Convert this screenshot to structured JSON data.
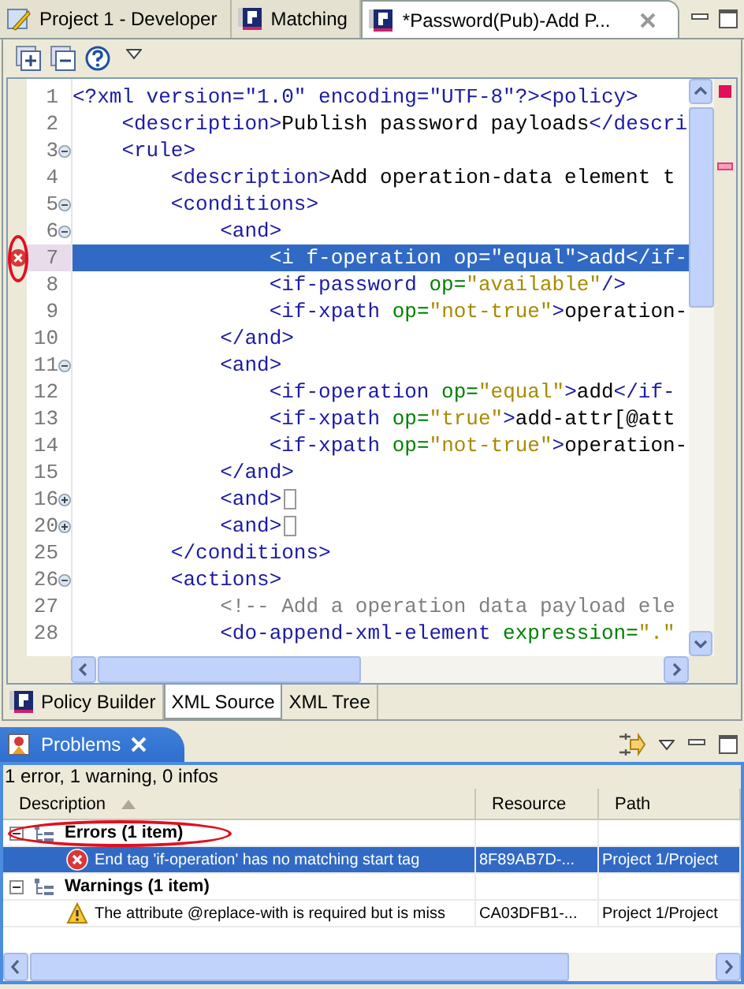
{
  "editor_tabs": [
    {
      "label": "Project 1 - Developer",
      "kind": "project",
      "selected": false,
      "closable": false
    },
    {
      "label": "Matching",
      "kind": "policy",
      "selected": false,
      "closable": false
    },
    {
      "label": "*Password(Pub)-Add P...",
      "kind": "policy",
      "selected": true,
      "closable": true
    }
  ],
  "editor": {
    "lines": [
      {
        "number": "1",
        "selected": false,
        "segments": [
          {
            "kind": "tag",
            "text": "<?xml version=\"1.0\" encoding=\"UTF-8\"?><policy>"
          }
        ]
      },
      {
        "number": "2",
        "selected": false,
        "segments": [
          {
            "kind": "tag",
            "text": "    <description>"
          },
          {
            "kind": "text",
            "text": "Publish password payloads"
          },
          {
            "kind": "tag",
            "text": "</descri"
          }
        ]
      },
      {
        "number": "3",
        "expanded": true,
        "selected": false,
        "segments": [
          {
            "kind": "tag",
            "text": "    <rule>"
          }
        ]
      },
      {
        "number": "4",
        "selected": false,
        "segments": [
          {
            "kind": "tag",
            "text": "        <description>"
          },
          {
            "kind": "text",
            "text": "Add operation-data element t"
          }
        ]
      },
      {
        "number": "5",
        "expanded": true,
        "selected": false,
        "segments": [
          {
            "kind": "tag",
            "text": "        <conditions>"
          }
        ]
      },
      {
        "number": "6",
        "expanded": true,
        "selected": false,
        "segments": [
          {
            "kind": "tag",
            "text": "            <and>"
          }
        ]
      },
      {
        "number": "7",
        "selected": true,
        "error": true,
        "circled": true,
        "segments": [
          {
            "kind": "tag",
            "text": "                <i f-operation op=\"equal\">add</if-"
          }
        ]
      },
      {
        "number": "8",
        "selected": false,
        "segments": [
          {
            "kind": "tag",
            "text": "                <if-password"
          },
          {
            "kind": "attr",
            "text": " op="
          },
          {
            "kind": "value",
            "text": "\"available\""
          },
          {
            "kind": "tag",
            "text": "/>"
          }
        ]
      },
      {
        "number": "9",
        "selected": false,
        "segments": [
          {
            "kind": "tag",
            "text": "                <if-xpath"
          },
          {
            "kind": "attr",
            "text": " op="
          },
          {
            "kind": "value",
            "text": "\"not-true\""
          },
          {
            "kind": "tag",
            "text": ">"
          },
          {
            "kind": "text",
            "text": "operation-"
          }
        ]
      },
      {
        "number": "10",
        "selected": false,
        "segments": [
          {
            "kind": "tag",
            "text": "            </and>"
          }
        ]
      },
      {
        "number": "11",
        "expanded": true,
        "selected": false,
        "segments": [
          {
            "kind": "tag",
            "text": "            <and>"
          }
        ]
      },
      {
        "number": "12",
        "selected": false,
        "segments": [
          {
            "kind": "tag",
            "text": "                <if-operation"
          },
          {
            "kind": "attr",
            "text": " op="
          },
          {
            "kind": "value",
            "text": "\"equal\""
          },
          {
            "kind": "tag",
            "text": ">"
          },
          {
            "kind": "text",
            "text": "add"
          },
          {
            "kind": "tag",
            "text": "</if-"
          }
        ]
      },
      {
        "number": "13",
        "selected": false,
        "segments": [
          {
            "kind": "tag",
            "text": "                <if-xpath"
          },
          {
            "kind": "attr",
            "text": " op="
          },
          {
            "kind": "value",
            "text": "\"true\""
          },
          {
            "kind": "tag",
            "text": ">"
          },
          {
            "kind": "text",
            "text": "add-attr[@att"
          }
        ]
      },
      {
        "number": "14",
        "selected": false,
        "segments": [
          {
            "kind": "tag",
            "text": "                <if-xpath"
          },
          {
            "kind": "attr",
            "text": " op="
          },
          {
            "kind": "value",
            "text": "\"not-true\""
          },
          {
            "kind": "tag",
            "text": ">"
          },
          {
            "kind": "text",
            "text": "operation-"
          }
        ]
      },
      {
        "number": "15",
        "selected": false,
        "segments": [
          {
            "kind": "tag",
            "text": "            </and>"
          }
        ]
      },
      {
        "number": "16",
        "expanded": false,
        "selected": false,
        "segments": [
          {
            "kind": "tag",
            "text": "            <and>"
          }
        ]
      },
      {
        "number": "20",
        "expanded": false,
        "selected": false,
        "segments": [
          {
            "kind": "tag",
            "text": "            <and>"
          }
        ]
      },
      {
        "number": "25",
        "selected": false,
        "segments": [
          {
            "kind": "tag",
            "text": "        </conditions>"
          }
        ]
      },
      {
        "number": "26",
        "expanded": true,
        "selected": false,
        "segments": [
          {
            "kind": "tag",
            "text": "        <actions>"
          }
        ]
      },
      {
        "number": "27",
        "selected": false,
        "segments": [
          {
            "kind": "comment",
            "text": "            <!-- Add a operation data payload ele"
          }
        ]
      },
      {
        "number": "28",
        "selected": false,
        "segments": [
          {
            "kind": "tag",
            "text": "            <do-append-xml-element"
          },
          {
            "kind": "attr",
            "text": " expression="
          },
          {
            "kind": "value",
            "text": "\".\""
          }
        ]
      }
    ]
  },
  "editor_bottom_tabs": [
    {
      "label": "Policy Builder",
      "kind": "policy",
      "selected": false
    },
    {
      "label": "XML Source",
      "kind": "plain",
      "selected": true
    },
    {
      "label": "XML Tree",
      "kind": "plain",
      "selected": false
    }
  ],
  "problems": {
    "title": "Problems",
    "summary": "1 error, 1 warning, 0 infos",
    "columns": [
      {
        "label": "Description",
        "sorted": true
      },
      {
        "label": "Resource",
        "sorted": false
      },
      {
        "label": "Path",
        "sorted": false
      }
    ],
    "groups": [
      {
        "label": "Errors (1 item)",
        "expanded": true,
        "circled": true,
        "items": [
          {
            "kind": "error",
            "description": "End tag 'if-operation' has no matching start tag",
            "resource": "8F89AB7D-...",
            "path": "Project 1/Project",
            "selected": true
          }
        ]
      },
      {
        "label": "Warnings (1 item)",
        "expanded": true,
        "items": [
          {
            "kind": "warning",
            "description": "The attribute @replace-with is required but is miss",
            "resource": "CA03DFB1-...",
            "path": "Project 1/Project",
            "selected": false
          }
        ]
      }
    ]
  }
}
